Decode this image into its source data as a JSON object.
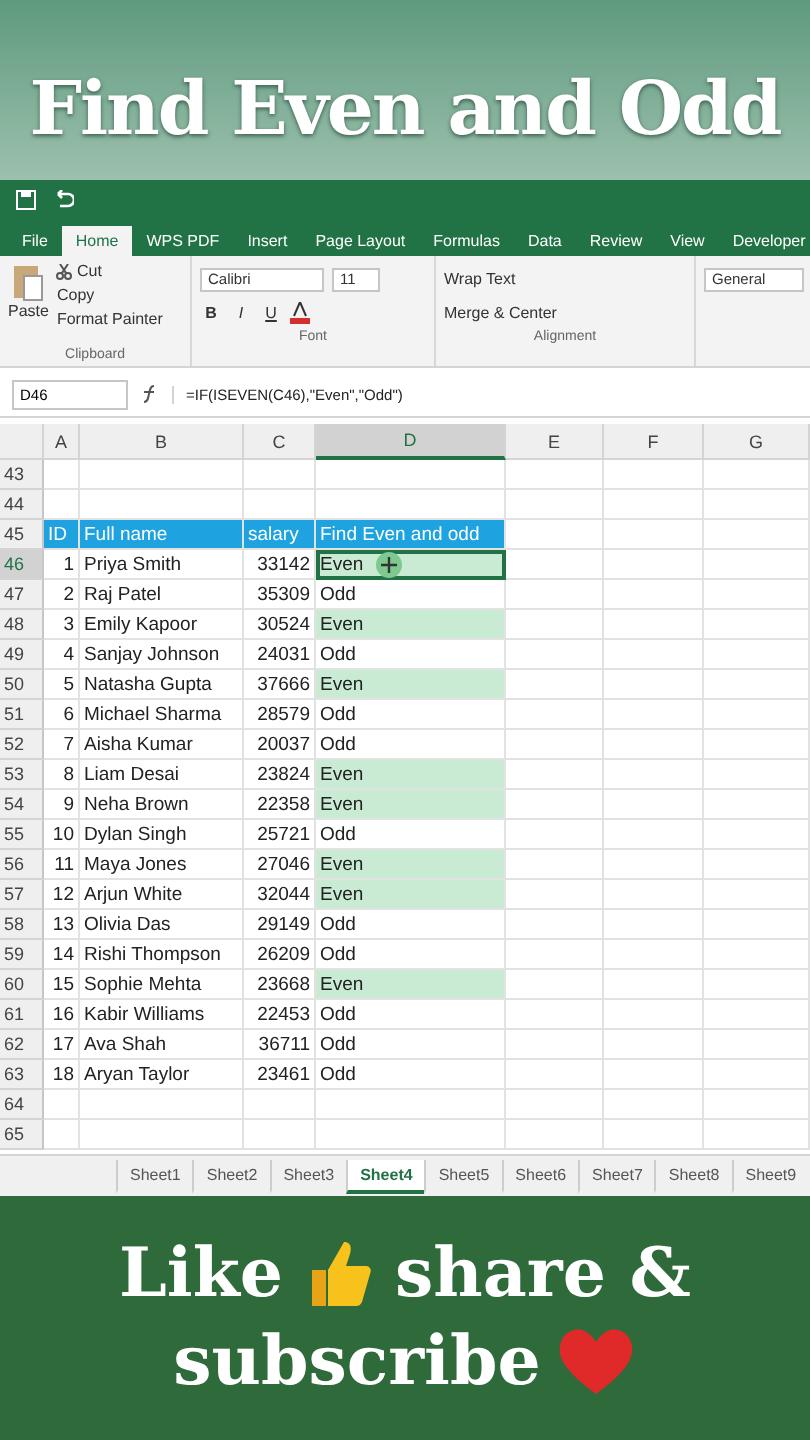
{
  "banner": {
    "title": "Find Even and Odd"
  },
  "ribbon_tabs": [
    {
      "label": "File",
      "selected": false
    },
    {
      "label": "Home",
      "selected": true
    },
    {
      "label": "WPS PDF",
      "selected": false
    },
    {
      "label": "Insert",
      "selected": false
    },
    {
      "label": "Page Layout",
      "selected": false
    },
    {
      "label": "Formulas",
      "selected": false
    },
    {
      "label": "Data",
      "selected": false
    },
    {
      "label": "Review",
      "selected": false
    },
    {
      "label": "View",
      "selected": false
    },
    {
      "label": "Developer",
      "selected": false
    }
  ],
  "clipboard": {
    "paste": "Paste",
    "cut": "Cut",
    "copy": "Copy",
    "format_painter": "Format Painter",
    "group": "Clipboard"
  },
  "font": {
    "name": "Calibri",
    "size": "11",
    "bold": "B",
    "italic": "I",
    "underline": "U",
    "group": "Font"
  },
  "alignment": {
    "wrap": "Wrap Text",
    "merge": "Merge & Center",
    "group": "Alignment"
  },
  "number": {
    "format": "General"
  },
  "formula_bar": {
    "name_box": "D46",
    "formula": "=IF(ISEVEN(C46),\"Even\",\"Odd\")"
  },
  "columns": [
    {
      "label": "A",
      "selected": false
    },
    {
      "label": "B",
      "selected": false
    },
    {
      "label": "C",
      "selected": false
    },
    {
      "label": "D",
      "selected": true
    },
    {
      "label": "E",
      "selected": false
    },
    {
      "label": "F",
      "selected": false
    },
    {
      "label": "G",
      "selected": false
    }
  ],
  "header_row": {
    "number": "45",
    "cells": [
      "ID",
      "Full name",
      "salary",
      "Find Even and odd"
    ]
  },
  "empty_rows_before": [
    "43",
    "44"
  ],
  "rows": [
    {
      "number": "46",
      "id": "1",
      "name": "Priya Smith",
      "salary": "33142",
      "result": "Even",
      "highlighted": true,
      "selected": true
    },
    {
      "number": "47",
      "id": "2",
      "name": "Raj Patel",
      "salary": "35309",
      "result": "Odd",
      "highlighted": false,
      "selected": false
    },
    {
      "number": "48",
      "id": "3",
      "name": "Emily Kapoor",
      "salary": "30524",
      "result": "Even",
      "highlighted": true,
      "selected": false
    },
    {
      "number": "49",
      "id": "4",
      "name": "Sanjay Johnson",
      "salary": "24031",
      "result": "Odd",
      "highlighted": false,
      "selected": false
    },
    {
      "number": "50",
      "id": "5",
      "name": "Natasha Gupta",
      "salary": "37666",
      "result": "Even",
      "highlighted": true,
      "selected": false
    },
    {
      "number": "51",
      "id": "6",
      "name": "Michael Sharma",
      "salary": "28579",
      "result": "Odd",
      "highlighted": false,
      "selected": false
    },
    {
      "number": "52",
      "id": "7",
      "name": "Aisha Kumar",
      "salary": "20037",
      "result": "Odd",
      "highlighted": false,
      "selected": false
    },
    {
      "number": "53",
      "id": "8",
      "name": "Liam Desai",
      "salary": "23824",
      "result": "Even",
      "highlighted": true,
      "selected": false
    },
    {
      "number": "54",
      "id": "9",
      "name": "Neha Brown",
      "salary": "22358",
      "result": "Even",
      "highlighted": true,
      "selected": false
    },
    {
      "number": "55",
      "id": "10",
      "name": "Dylan Singh",
      "salary": "25721",
      "result": "Odd",
      "highlighted": false,
      "selected": false
    },
    {
      "number": "56",
      "id": "11",
      "name": "Maya Jones",
      "salary": "27046",
      "result": "Even",
      "highlighted": true,
      "selected": false
    },
    {
      "number": "57",
      "id": "12",
      "name": "Arjun White",
      "salary": "32044",
      "result": "Even",
      "highlighted": true,
      "selected": false
    },
    {
      "number": "58",
      "id": "13",
      "name": "Olivia Das",
      "salary": "29149",
      "result": "Odd",
      "highlighted": false,
      "selected": false
    },
    {
      "number": "59",
      "id": "14",
      "name": "Rishi Thompson",
      "salary": "26209",
      "result": "Odd",
      "highlighted": false,
      "selected": false
    },
    {
      "number": "60",
      "id": "15",
      "name": "Sophie Mehta",
      "salary": "23668",
      "result": "Even",
      "highlighted": true,
      "selected": false
    },
    {
      "number": "61",
      "id": "16",
      "name": "Kabir Williams",
      "salary": "22453",
      "result": "Odd",
      "highlighted": false,
      "selected": false
    },
    {
      "number": "62",
      "id": "17",
      "name": "Ava Shah",
      "salary": "36711",
      "result": "Odd",
      "highlighted": false,
      "selected": false
    },
    {
      "number": "63",
      "id": "18",
      "name": "Aryan Taylor",
      "salary": "23461",
      "result": "Odd",
      "highlighted": false,
      "selected": false
    }
  ],
  "empty_rows_after": [
    "64",
    "65"
  ],
  "sheet_tabs": [
    {
      "label": "Sheet1",
      "selected": false
    },
    {
      "label": "Sheet2",
      "selected": false
    },
    {
      "label": "Sheet3",
      "selected": false
    },
    {
      "label": "Sheet4",
      "selected": true
    },
    {
      "label": "Sheet5",
      "selected": false
    },
    {
      "label": "Sheet6",
      "selected": false
    },
    {
      "label": "Sheet7",
      "selected": false
    },
    {
      "label": "Sheet8",
      "selected": false
    },
    {
      "label": "Sheet9",
      "selected": false
    }
  ],
  "footer": {
    "line1_a": "Like",
    "line1_b": "share &",
    "line2": "subscribe"
  }
}
